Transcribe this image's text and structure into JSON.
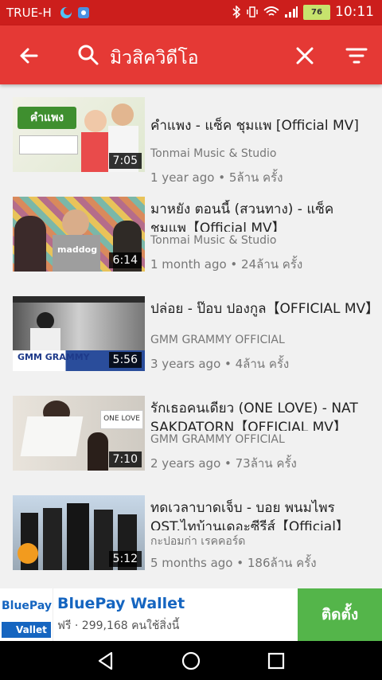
{
  "status": {
    "carrier": "TRUE-H",
    "battery": "76",
    "time": "10:11"
  },
  "search": {
    "query": "มิวสิควิดีโอ"
  },
  "icons": {
    "back": "arrow-back-icon",
    "search": "search-icon",
    "clear": "close-icon",
    "filter": "filter-icon"
  },
  "videos": [
    {
      "title": "คำแพง - แซ็ค ชุมแพ [Official MV]",
      "channel": "Tonmai Music & Studio",
      "age": "1 year ago",
      "views": "5ล้าน ครั้ง",
      "duration": "7:05",
      "thumb_text": "คำแพง"
    },
    {
      "title": "มาหยัง ตอนนี้ (สวนทาง) - แซ็ค ชุมแพ【Official MV】",
      "channel": "Tonmai Music & Studio",
      "age": "1 month ago",
      "views": "24ล้าน ครั้ง",
      "duration": "6:14",
      "thumb_text": "maddog"
    },
    {
      "title": "ปล่อย - ป๊อบ ปองกูล【OFFICIAL MV】",
      "channel": "GMM GRAMMY OFFICIAL",
      "age": "3 years ago",
      "views": "4ล้าน ครั้ง",
      "duration": "5:56",
      "thumb_text": "GMM GRAMMY"
    },
    {
      "title": "รักเธอคนเดียว (ONE LOVE) - NAT SAKDATORN【OFFICIAL MV】",
      "channel": "GMM GRAMMY OFFICIAL",
      "age": "2 years ago",
      "views": "73ล้าน ครั้ง",
      "duration": "7:10",
      "thumb_text": "ONE LOVE"
    },
    {
      "title": "ทดเวลาบาดเจ็บ - บอย พนมไพร OST.ไทบ้านเดอะซีรีส์【Official】",
      "channel": "กะปอมก่า เรคคอร์ด",
      "age": "5 months ago",
      "views": "186ล้าน ครั้ง",
      "duration": "5:12",
      "thumb_text": ""
    }
  ],
  "ad": {
    "logo_top": "BluePay",
    "logo_bottom": "Vallet",
    "title": "BluePay Wallet",
    "subtitle": "ฟรี · 299,168 คนใช้สิ่งนี้",
    "install": "ติดตั้ง"
  },
  "colors": {
    "status_bar": "#cc1e1c",
    "app_bar": "#e53935",
    "install": "#54b54a"
  }
}
